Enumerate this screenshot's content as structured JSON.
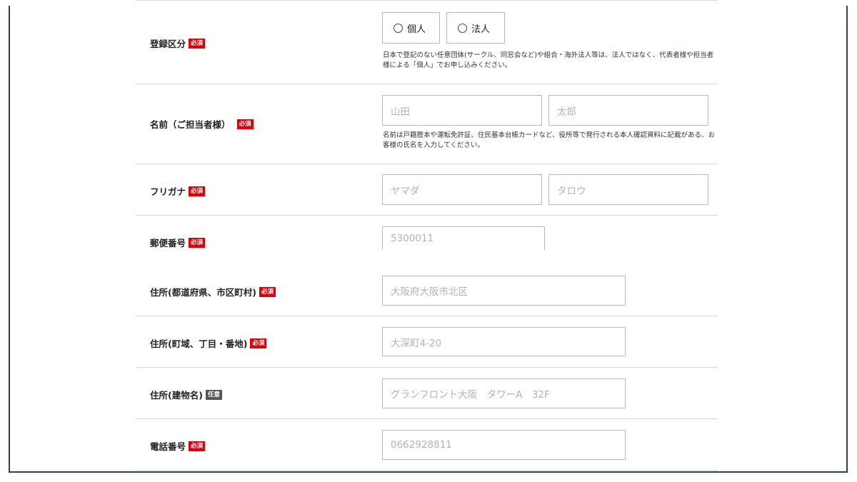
{
  "badges": {
    "required": "必須",
    "optional": "任意"
  },
  "fields": {
    "registration_type": {
      "label": "登録区分",
      "options": [
        "個人",
        "法人"
      ],
      "note": "日本で登記のない任意団体(サークル、同窓会など)や組合・海外法人等は、法人ではなく、代表者様や担当者様による「個人」でお申し込みください。"
    },
    "name": {
      "label": "名前（ご担当者様）",
      "last_placeholder": "山田",
      "first_placeholder": "太郎",
      "note": "名前は戸籍謄本や運転免許証、住民基本台帳カードなど、役所等で発行される本人確認資料に記載がある、お客様の氏名を入力してください。"
    },
    "furigana": {
      "label": "フリガナ",
      "last_placeholder": "ヤマダ",
      "first_placeholder": "タロウ"
    },
    "postal_code": {
      "label": "郵便番号",
      "placeholder": "5300011"
    },
    "address_pref_city": {
      "label": "住所(都道府県、市区町村)",
      "placeholder": "大阪府大阪市北区"
    },
    "address_town": {
      "label": "住所(町域、丁目・番地)",
      "placeholder": "大深町4-20"
    },
    "address_building": {
      "label": "住所(建物名)",
      "placeholder": "グランフロント大阪　タワーA　32F"
    },
    "phone": {
      "label": "電話番号",
      "placeholder": "0662928811"
    }
  },
  "colors": {
    "required_badge": "#d9000d",
    "optional_badge": "#555555",
    "frame_border": "#2e3f5c",
    "input_border": "#b9b9b9",
    "placeholder_text": "#b2b2b2"
  }
}
